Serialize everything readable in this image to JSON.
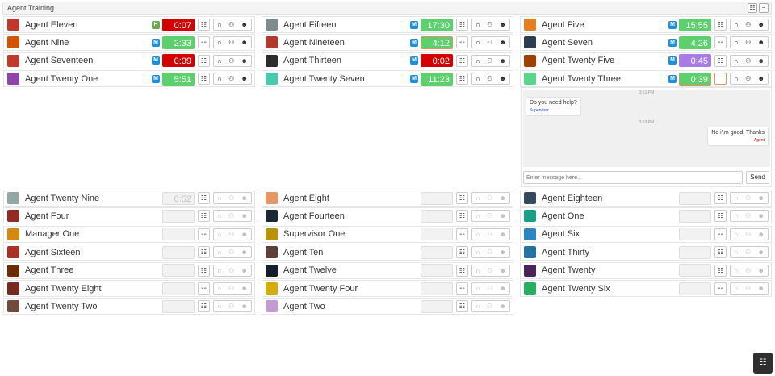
{
  "window": {
    "title": "Agent Training",
    "chat_icon": "chat-bubble-icon",
    "minimize_icon": "minimize-icon"
  },
  "icons": {
    "chat": "chat-bubble-icon",
    "listen": "headset-icon",
    "whisper": "group-icon",
    "barge": "person-icon"
  },
  "colors": {
    "green": "#5cd06c",
    "red": "#d40000",
    "purple": "#a77ce8",
    "badge_blue": "#1e90d8",
    "badge_green": "#6aa84f"
  },
  "active_agents": [
    {
      "name": "Agent Eleven",
      "badge": "H",
      "badge_color": "#6aa84f",
      "timer": "0:07",
      "state": "red",
      "avatar": "#c0392b"
    },
    {
      "name": "Agent Fifteen",
      "badge": "M",
      "badge_color": "#1e90d8",
      "timer": "17:30",
      "state": "green",
      "avatar": "#7f8c8d"
    },
    {
      "name": "Agent Five",
      "badge": "M",
      "badge_color": "#1e90d8",
      "timer": "15:55",
      "state": "green",
      "avatar": "#e67e22"
    },
    {
      "name": "Agent Nine",
      "badge": "M",
      "badge_color": "#1e90d8",
      "timer": "2:33",
      "state": "green",
      "avatar": "#d35400"
    },
    {
      "name": "Agent Nineteen",
      "badge": "M",
      "badge_color": "#1e90d8",
      "timer": "4:12",
      "state": "green-outlined",
      "avatar": "#b03a2e"
    },
    {
      "name": "Agent Seven",
      "badge": "M",
      "badge_color": "#1e90d8",
      "timer": "4:26",
      "state": "green",
      "avatar": "#2c3e50"
    },
    {
      "name": "Agent Seventeen",
      "badge": "M",
      "badge_color": "#1e90d8",
      "timer": "0:09",
      "state": "red",
      "avatar": "#c0392b"
    },
    {
      "name": "Agent Thirteen",
      "badge": "M",
      "badge_color": "#1e90d8",
      "timer": "0:02",
      "state": "red",
      "avatar": "#2d2d2d"
    },
    {
      "name": "Agent Twenty Five",
      "badge": "M",
      "badge_color": "#1e90d8",
      "timer": "0:45",
      "state": "purple",
      "avatar": "#a04000"
    },
    {
      "name": "Agent Twenty One",
      "badge": "M",
      "badge_color": "#1e90d8",
      "timer": "5:51",
      "state": "green",
      "avatar": "#8e44ad"
    },
    {
      "name": "Agent Twenty Seven",
      "badge": "M",
      "badge_color": "#1e90d8",
      "timer": "11:23",
      "state": "green",
      "avatar": "#48c9b0"
    },
    {
      "name": "Agent Twenty Three",
      "badge": "M",
      "badge_color": "#1e90d8",
      "timer": "0:39",
      "state": "green-outlined",
      "avatar": "#58d68d",
      "chat_open": true
    }
  ],
  "chat": {
    "time_1": "3:51 PM",
    "message_1": "Do you need help?",
    "sender_1": "Supervisor",
    "time_2": "3:53 PM",
    "message_2": "No i',m good, Thanks",
    "sender_2": "Agent",
    "input_placeholder": "Enter message here...",
    "send_label": "Send"
  },
  "idle_agents": [
    {
      "name": "Agent Twenty Nine",
      "timer": "0:52",
      "avatar": "#95a5a6"
    },
    {
      "name": "Agent Eight",
      "timer": "",
      "avatar": "#e59866"
    },
    {
      "name": "Agent Eighteen",
      "timer": "",
      "avatar": "#34495e"
    },
    {
      "name": "Agent Four",
      "timer": "",
      "avatar": "#922b21"
    },
    {
      "name": "Agent Fourteen",
      "timer": "",
      "avatar": "#1c2833"
    },
    {
      "name": "Agent One",
      "timer": "",
      "avatar": "#16a085"
    },
    {
      "name": "Manager One",
      "timer": "",
      "avatar": "#d68910"
    },
    {
      "name": "Supervisor One",
      "timer": "",
      "avatar": "#b7950b"
    },
    {
      "name": "Agent Six",
      "timer": "",
      "avatar": "#2e86c1"
    },
    {
      "name": "Agent Sixteen",
      "timer": "",
      "avatar": "#a93226"
    },
    {
      "name": "Agent Ten",
      "timer": "",
      "avatar": "#5d4037"
    },
    {
      "name": "Agent Thirty",
      "timer": "",
      "avatar": "#2471a3"
    },
    {
      "name": "Agent Three",
      "timer": "",
      "avatar": "#6e2c00"
    },
    {
      "name": "Agent Twelve",
      "timer": "",
      "avatar": "#17202a"
    },
    {
      "name": "Agent Twenty",
      "timer": "",
      "avatar": "#4a235a"
    },
    {
      "name": "Agent Twenty Eight",
      "timer": "",
      "avatar": "#78281f"
    },
    {
      "name": "Agent Twenty Four",
      "timer": "",
      "avatar": "#d4ac0d"
    },
    {
      "name": "Agent Twenty Six",
      "timer": "",
      "avatar": "#27ae60"
    },
    {
      "name": "Agent Twenty Two",
      "timer": "",
      "avatar": "#6e4b3a"
    },
    {
      "name": "Agent Two",
      "timer": "",
      "avatar": "#c39bd3"
    }
  ],
  "floating_chat_icon": "chat-bubble-icon"
}
